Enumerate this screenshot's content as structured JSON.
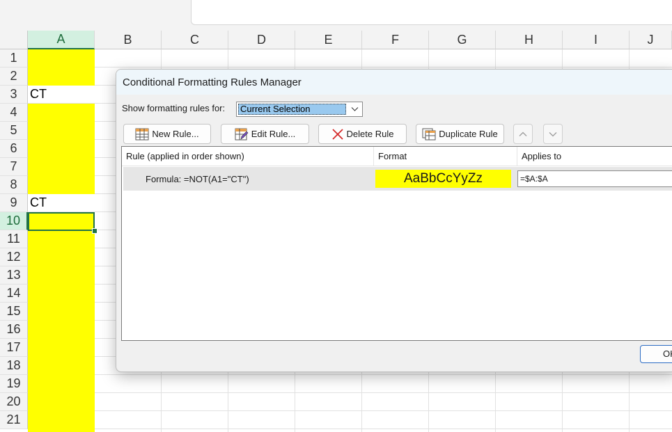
{
  "spreadsheet": {
    "columns": [
      "A",
      "B",
      "C",
      "D",
      "E",
      "F",
      "G",
      "H",
      "I",
      "J"
    ],
    "selected_column": "A",
    "rows": [
      "1",
      "2",
      "3",
      "4",
      "5",
      "6",
      "7",
      "8",
      "9",
      "10",
      "11",
      "12",
      "13",
      "14",
      "15",
      "16",
      "17",
      "18",
      "19",
      "20",
      "21"
    ],
    "selected_row": "10",
    "cells": {
      "A3": "CT",
      "A9": "CT"
    },
    "fill_color": "#ffff00",
    "accent_color": "#217346"
  },
  "dialog": {
    "title": "Conditional Formatting Rules Manager",
    "show_rules_label": "Show formatting rules for:",
    "show_rules_value": "Current Selection",
    "toolbar": {
      "new_rule": "New Rule...",
      "edit_rule": "Edit Rule...",
      "delete_rule": "Delete Rule",
      "duplicate_rule": "Duplicate Rule"
    },
    "columns": {
      "rule": "Rule (applied in order shown)",
      "format": "Format",
      "applies_to": "Applies to"
    },
    "rules": [
      {
        "rule": "Formula: =NOT(A1=\"CT\")",
        "format_preview": "AaBbCcYyZz",
        "applies_to": "=$A:$A"
      }
    ],
    "ok_button": "OK"
  }
}
